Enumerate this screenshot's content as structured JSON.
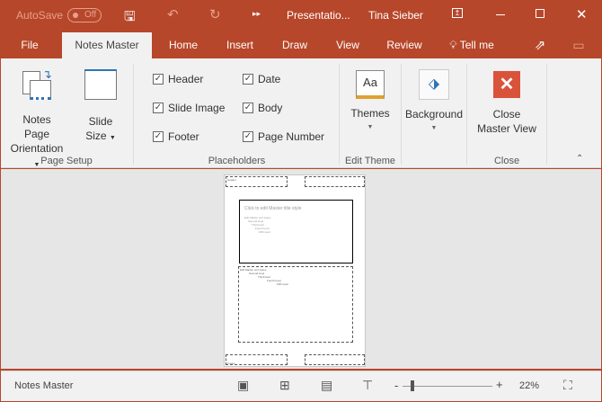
{
  "titlebar": {
    "autosave": "AutoSave",
    "toggle": "Off",
    "doc_title": "Presentatio...",
    "user": "Tina Sieber"
  },
  "tabs": [
    "File",
    "Notes Master",
    "Home",
    "Insert",
    "Draw",
    "View",
    "Review",
    "Tell me"
  ],
  "ribbon": {
    "page_setup": {
      "orientation_l1": "Notes Page",
      "orientation_l2": "Orientation",
      "size_l1": "Slide",
      "size_l2": "Size",
      "label": "Page Setup"
    },
    "placeholders": {
      "items": [
        {
          "label": "Header",
          "checked": true
        },
        {
          "label": "Slide Image",
          "checked": true
        },
        {
          "label": "Footer",
          "checked": true
        },
        {
          "label": "Date",
          "checked": true
        },
        {
          "label": "Body",
          "checked": true
        },
        {
          "label": "Page Number",
          "checked": true
        }
      ],
      "label": "Placeholders"
    },
    "edit_theme": {
      "themes": "Themes",
      "label": "Edit Theme",
      "themes_icon_text": "Aa"
    },
    "background": {
      "label": "Background"
    },
    "close": {
      "l1": "Close",
      "l2": "Master View",
      "label": "Close"
    }
  },
  "page": {
    "header": "Header",
    "footer": "Footer",
    "slide_title": "Click to edit Master title style",
    "body_levels": [
      "Edit Master text styles",
      "Second level",
      "Third level",
      "Fourth level",
      "Fifth level"
    ]
  },
  "status": {
    "mode": "Notes Master",
    "zoom": "22%",
    "zoom_percent": 22
  },
  "colors": {
    "accent": "#b7472a",
    "close_red": "#d9533a"
  }
}
